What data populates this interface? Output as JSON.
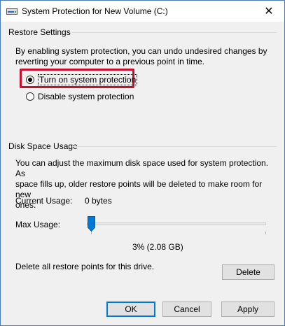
{
  "window": {
    "title": "System Protection for New Volume (C:)",
    "close_glyph": "✕"
  },
  "restore_settings": {
    "group_label": "Restore Settings",
    "description_line1": "By enabling system protection, you can undo undesired changes by",
    "description_line2": "reverting your computer to a previous point in time.",
    "options": [
      {
        "label": "Turn on system protection",
        "selected": true
      },
      {
        "label": "Disable system protection",
        "selected": false
      }
    ]
  },
  "disk_space": {
    "group_label": "Disk Space Usage",
    "description_line1": "You can adjust the maximum disk space used for system protection. As",
    "description_line2": "space fills up, older restore points will be deleted to make room for new",
    "description_line3": "ones.",
    "current_usage_label": "Current Usage:",
    "current_usage_value": "0 bytes",
    "max_usage_label": "Max Usage:",
    "max_usage_value": "3% (2.08 GB)",
    "max_usage_percent": 3,
    "delete_text": "Delete all restore points for this drive.",
    "delete_button": "Delete"
  },
  "footer": {
    "ok": "OK",
    "cancel": "Cancel",
    "apply": "Apply"
  },
  "colors": {
    "highlight_border": "#c8102e",
    "default_button_border": "#0078d7",
    "slider_thumb": "#0078d7"
  },
  "icons": {
    "title": "drive-icon",
    "close": "close-icon"
  }
}
